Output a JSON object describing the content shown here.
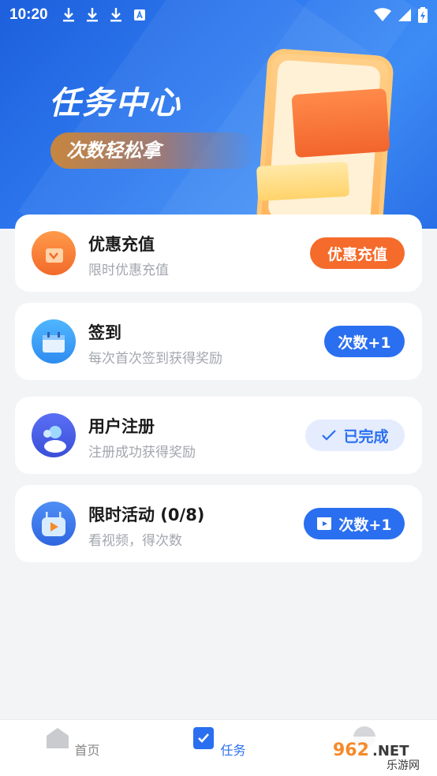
{
  "status_bar": {
    "time": "10:20"
  },
  "banner": {
    "title": "任务中心",
    "subtitle": "次数轻松拿"
  },
  "tasks": [
    {
      "name": "优惠充值",
      "desc": "限时优惠充值",
      "button": "优惠充值",
      "icon": "discount-icon",
      "button_color": "#f56b2b"
    },
    {
      "name": "签到",
      "desc": "每次首次签到获得奖励",
      "button": "次数+1",
      "icon": "calendar-icon",
      "button_color": "#2a6ff0"
    },
    {
      "name": "用户注册",
      "desc": "注册成功获得奖励",
      "button": "已完成",
      "icon": "user-register-icon",
      "button_color": "#e4ecfd"
    },
    {
      "name": "限时活动 (0/8)",
      "desc": "看视频，得次数",
      "button": "次数+1",
      "icon": "tv-robot-icon",
      "button_color": "#2a6ff0"
    }
  ],
  "nav": {
    "items": [
      {
        "label": "首页",
        "icon": "home-icon",
        "active": false
      },
      {
        "label": "任务",
        "icon": "task-icon",
        "active": true
      }
    ]
  },
  "watermark": {
    "text": "962.NET",
    "subtext": "乐游网"
  },
  "colors": {
    "accent": "#2a6ff0",
    "orange": "#f56b2b",
    "banner": "#2f7bf0"
  }
}
